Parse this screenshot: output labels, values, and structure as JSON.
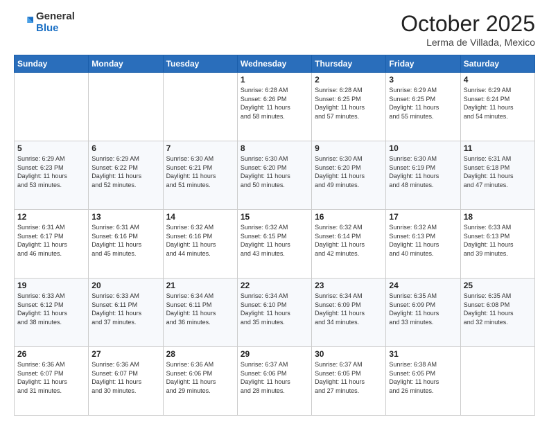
{
  "header": {
    "logo_general": "General",
    "logo_blue": "Blue",
    "month_title": "October 2025",
    "subtitle": "Lerma de Villada, Mexico"
  },
  "days_of_week": [
    "Sunday",
    "Monday",
    "Tuesday",
    "Wednesday",
    "Thursday",
    "Friday",
    "Saturday"
  ],
  "weeks": [
    [
      {
        "day": "",
        "info": ""
      },
      {
        "day": "",
        "info": ""
      },
      {
        "day": "",
        "info": ""
      },
      {
        "day": "1",
        "info": "Sunrise: 6:28 AM\nSunset: 6:26 PM\nDaylight: 11 hours\nand 58 minutes."
      },
      {
        "day": "2",
        "info": "Sunrise: 6:28 AM\nSunset: 6:25 PM\nDaylight: 11 hours\nand 57 minutes."
      },
      {
        "day": "3",
        "info": "Sunrise: 6:29 AM\nSunset: 6:25 PM\nDaylight: 11 hours\nand 55 minutes."
      },
      {
        "day": "4",
        "info": "Sunrise: 6:29 AM\nSunset: 6:24 PM\nDaylight: 11 hours\nand 54 minutes."
      }
    ],
    [
      {
        "day": "5",
        "info": "Sunrise: 6:29 AM\nSunset: 6:23 PM\nDaylight: 11 hours\nand 53 minutes."
      },
      {
        "day": "6",
        "info": "Sunrise: 6:29 AM\nSunset: 6:22 PM\nDaylight: 11 hours\nand 52 minutes."
      },
      {
        "day": "7",
        "info": "Sunrise: 6:30 AM\nSunset: 6:21 PM\nDaylight: 11 hours\nand 51 minutes."
      },
      {
        "day": "8",
        "info": "Sunrise: 6:30 AM\nSunset: 6:20 PM\nDaylight: 11 hours\nand 50 minutes."
      },
      {
        "day": "9",
        "info": "Sunrise: 6:30 AM\nSunset: 6:20 PM\nDaylight: 11 hours\nand 49 minutes."
      },
      {
        "day": "10",
        "info": "Sunrise: 6:30 AM\nSunset: 6:19 PM\nDaylight: 11 hours\nand 48 minutes."
      },
      {
        "day": "11",
        "info": "Sunrise: 6:31 AM\nSunset: 6:18 PM\nDaylight: 11 hours\nand 47 minutes."
      }
    ],
    [
      {
        "day": "12",
        "info": "Sunrise: 6:31 AM\nSunset: 6:17 PM\nDaylight: 11 hours\nand 46 minutes."
      },
      {
        "day": "13",
        "info": "Sunrise: 6:31 AM\nSunset: 6:16 PM\nDaylight: 11 hours\nand 45 minutes."
      },
      {
        "day": "14",
        "info": "Sunrise: 6:32 AM\nSunset: 6:16 PM\nDaylight: 11 hours\nand 44 minutes."
      },
      {
        "day": "15",
        "info": "Sunrise: 6:32 AM\nSunset: 6:15 PM\nDaylight: 11 hours\nand 43 minutes."
      },
      {
        "day": "16",
        "info": "Sunrise: 6:32 AM\nSunset: 6:14 PM\nDaylight: 11 hours\nand 42 minutes."
      },
      {
        "day": "17",
        "info": "Sunrise: 6:32 AM\nSunset: 6:13 PM\nDaylight: 11 hours\nand 40 minutes."
      },
      {
        "day": "18",
        "info": "Sunrise: 6:33 AM\nSunset: 6:13 PM\nDaylight: 11 hours\nand 39 minutes."
      }
    ],
    [
      {
        "day": "19",
        "info": "Sunrise: 6:33 AM\nSunset: 6:12 PM\nDaylight: 11 hours\nand 38 minutes."
      },
      {
        "day": "20",
        "info": "Sunrise: 6:33 AM\nSunset: 6:11 PM\nDaylight: 11 hours\nand 37 minutes."
      },
      {
        "day": "21",
        "info": "Sunrise: 6:34 AM\nSunset: 6:11 PM\nDaylight: 11 hours\nand 36 minutes."
      },
      {
        "day": "22",
        "info": "Sunrise: 6:34 AM\nSunset: 6:10 PM\nDaylight: 11 hours\nand 35 minutes."
      },
      {
        "day": "23",
        "info": "Sunrise: 6:34 AM\nSunset: 6:09 PM\nDaylight: 11 hours\nand 34 minutes."
      },
      {
        "day": "24",
        "info": "Sunrise: 6:35 AM\nSunset: 6:09 PM\nDaylight: 11 hours\nand 33 minutes."
      },
      {
        "day": "25",
        "info": "Sunrise: 6:35 AM\nSunset: 6:08 PM\nDaylight: 11 hours\nand 32 minutes."
      }
    ],
    [
      {
        "day": "26",
        "info": "Sunrise: 6:36 AM\nSunset: 6:07 PM\nDaylight: 11 hours\nand 31 minutes."
      },
      {
        "day": "27",
        "info": "Sunrise: 6:36 AM\nSunset: 6:07 PM\nDaylight: 11 hours\nand 30 minutes."
      },
      {
        "day": "28",
        "info": "Sunrise: 6:36 AM\nSunset: 6:06 PM\nDaylight: 11 hours\nand 29 minutes."
      },
      {
        "day": "29",
        "info": "Sunrise: 6:37 AM\nSunset: 6:06 PM\nDaylight: 11 hours\nand 28 minutes."
      },
      {
        "day": "30",
        "info": "Sunrise: 6:37 AM\nSunset: 6:05 PM\nDaylight: 11 hours\nand 27 minutes."
      },
      {
        "day": "31",
        "info": "Sunrise: 6:38 AM\nSunset: 6:05 PM\nDaylight: 11 hours\nand 26 minutes."
      },
      {
        "day": "",
        "info": ""
      }
    ]
  ]
}
